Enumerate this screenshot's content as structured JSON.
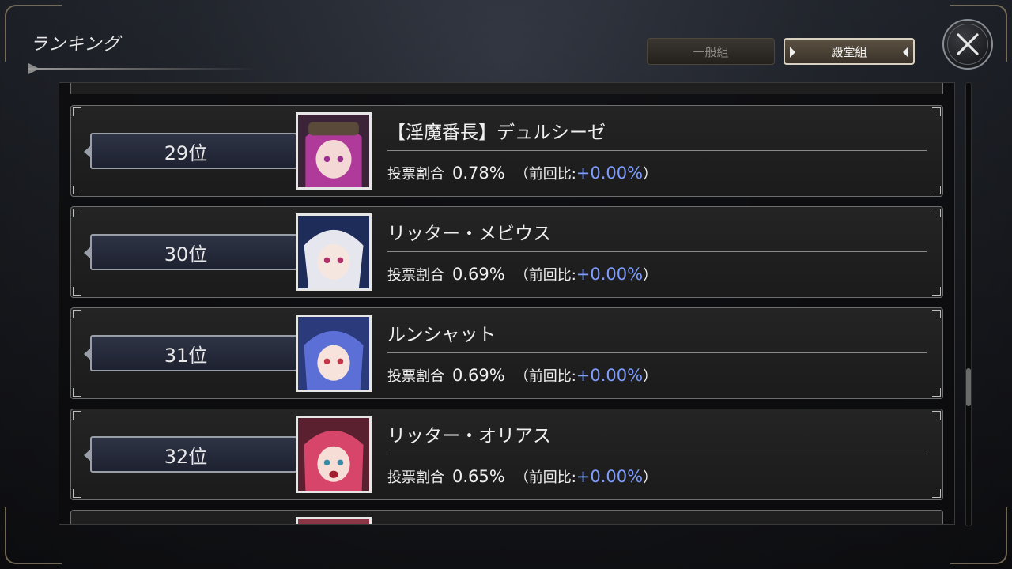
{
  "header": {
    "title": "ランキング"
  },
  "tabs": [
    {
      "label": "一般組",
      "active": false
    },
    {
      "label": "殿堂組",
      "active": true
    }
  ],
  "close": {
    "icon": "close-icon"
  },
  "colors": {
    "delta": "#7f9dff",
    "accent_border": "#d8d0c0"
  },
  "rankings": [
    {
      "rank": "29位",
      "name": "【淫魔番長】デュルシーゼ",
      "stat_label": "投票割合",
      "share": "0.78%",
      "prev_open": "（前回比:",
      "prev_delta": "+0.00%",
      "prev_close": "）",
      "portrait": "portrait-dulcise"
    },
    {
      "rank": "30位",
      "name": "リッター・メビウス",
      "stat_label": "投票割合",
      "share": "0.69%",
      "prev_open": "（前回比:",
      "prev_delta": "+0.00%",
      "prev_close": "）",
      "portrait": "portrait-mobius"
    },
    {
      "rank": "31位",
      "name": "ルンシャット",
      "stat_label": "投票割合",
      "share": "0.69%",
      "prev_open": "（前回比:",
      "prev_delta": "+0.00%",
      "prev_close": "）",
      "portrait": "portrait-runshat"
    },
    {
      "rank": "32位",
      "name": "リッター・オリアス",
      "stat_label": "投票割合",
      "share": "0.65%",
      "prev_open": "（前回比:",
      "prev_delta": "+0.00%",
      "prev_close": "）",
      "portrait": "portrait-orias"
    }
  ]
}
